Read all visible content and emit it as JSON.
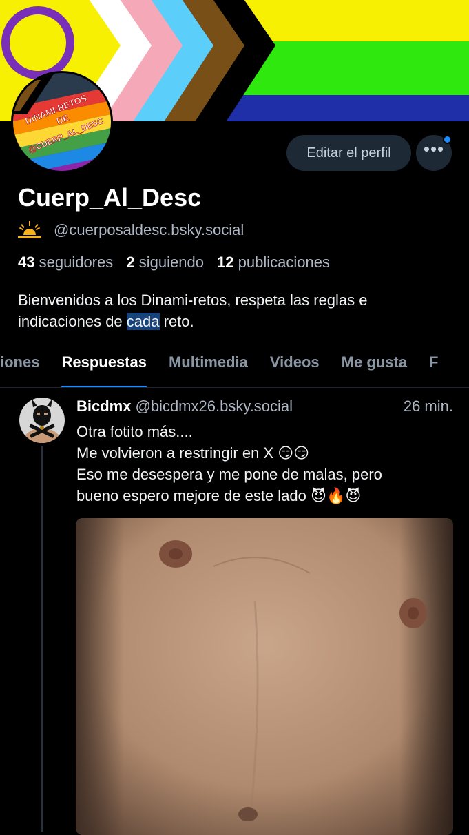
{
  "profile": {
    "display_name": "Cuerp_Al_Desc",
    "handle": "@cuerposaldesc.bsky.social",
    "avatar_text": [
      "DINAMI-RETOS",
      "DE",
      "@CUERP_AL_DESC"
    ],
    "stats": {
      "followers_count": "43",
      "followers_label": "seguidores",
      "following_count": "2",
      "following_label": "siguiendo",
      "posts_count": "12",
      "posts_label": "publicaciones"
    },
    "bio_before": "Bienvenidos a los Dinami-retos, respeta las reglas e indicaciones de ",
    "bio_highlight": "cada",
    "bio_after": " reto."
  },
  "actions": {
    "edit_profile": "Editar el perfil",
    "more": "•••"
  },
  "tabs": [
    {
      "label": "iones"
    },
    {
      "label": "Respuestas"
    },
    {
      "label": "Multimedia"
    },
    {
      "label": "Videos"
    },
    {
      "label": "Me gusta"
    },
    {
      "label": "F"
    }
  ],
  "active_tab": "Respuestas",
  "post": {
    "author": "Bicdmx",
    "handle": "@bicdmx26.bsky.social",
    "time": "26 min.",
    "lines": [
      "Otra fotito más....",
      "Me volvieron a restringir en X 😏😏",
      "Eso me desespera y me pone de malas, pero",
      "bueno espero mejore de este lado 😈🔥😈"
    ]
  },
  "colors": {
    "accent": "#1a8cff",
    "background": "#000000",
    "muted_text": "#aeb8c4",
    "button_bg": "#1e2936"
  }
}
